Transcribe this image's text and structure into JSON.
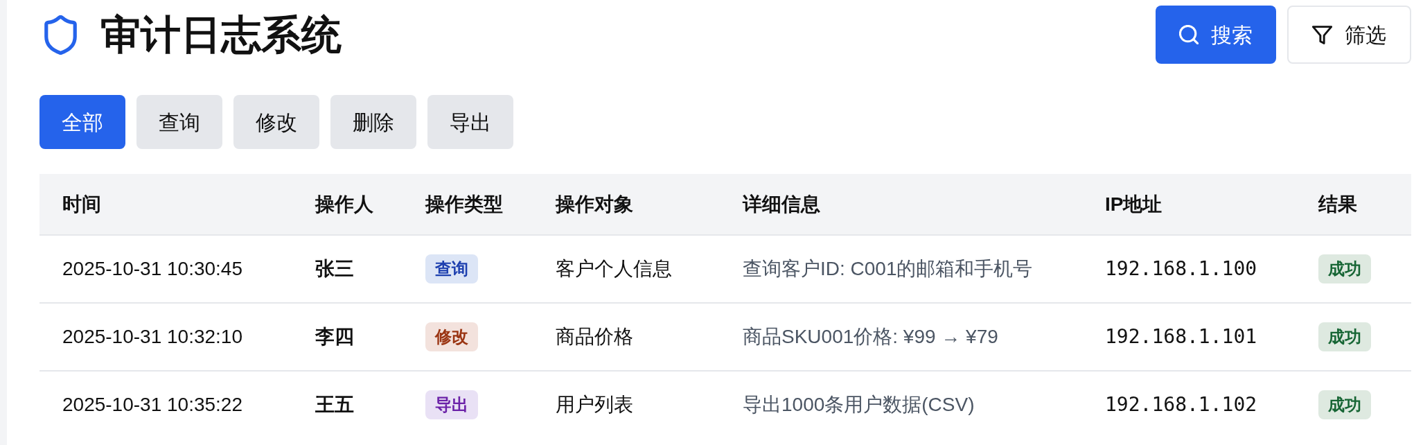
{
  "header": {
    "title": "审计日志系统",
    "buttons": [
      {
        "label": "搜索",
        "kind": "search"
      },
      {
        "label": "筛选",
        "kind": "filter"
      }
    ]
  },
  "filter_tabs": [
    {
      "label": "全部",
      "selected": true
    },
    {
      "label": "查询",
      "selected": false
    },
    {
      "label": "修改",
      "selected": false
    },
    {
      "label": "删除",
      "selected": false
    },
    {
      "label": "导出",
      "selected": false
    }
  ],
  "table": {
    "columns": [
      "时间",
      "操作人",
      "操作类型",
      "操作对象",
      "详细信息",
      "IP地址",
      "结果"
    ],
    "rows": [
      {
        "time": "2025-10-31 10:30:45",
        "operator": "张三",
        "type": {
          "label": "查询",
          "color": "#1e40af"
        },
        "target": "客户个人信息",
        "detail": "查询客户ID: C001的邮箱和手机号",
        "ip": "192.168.1.100",
        "result": {
          "label": "成功",
          "color": "#166534"
        }
      },
      {
        "time": "2025-10-31 10:32:10",
        "operator": "李四",
        "type": {
          "label": "修改",
          "color": "#9a3412"
        },
        "target": "商品价格",
        "detail": "商品SKU001价格: ¥99 → ¥79",
        "ip": "192.168.1.101",
        "result": {
          "label": "成功",
          "color": "#166534"
        }
      },
      {
        "time": "2025-10-31 10:35:22",
        "operator": "王五",
        "type": {
          "label": "导出",
          "color": "#6b21a8"
        },
        "target": "用户列表",
        "detail": "导出1000条用户数据(CSV)",
        "ip": "192.168.1.102",
        "result": {
          "label": "成功",
          "color": "#166534"
        }
      }
    ]
  }
}
